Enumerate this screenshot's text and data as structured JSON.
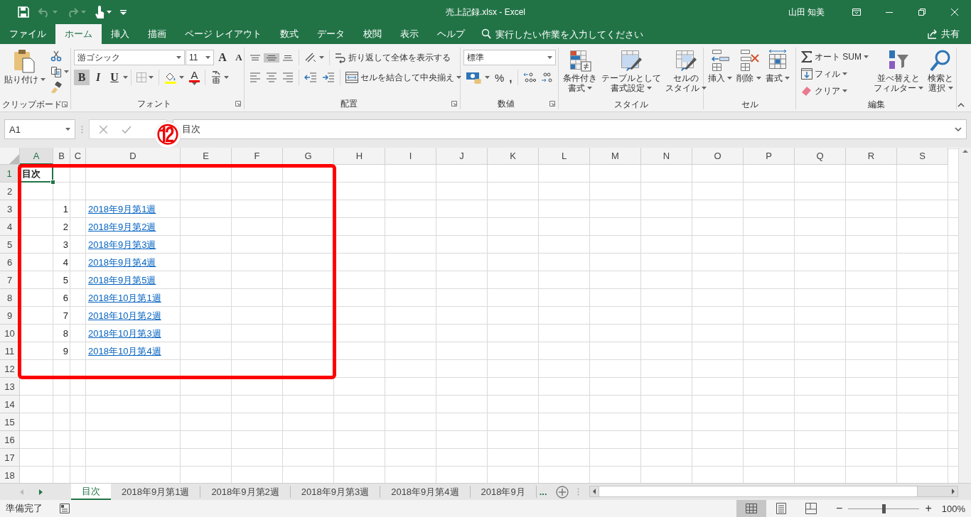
{
  "window": {
    "title": "売上記録.xlsx  -  Excel",
    "user": "山田 知美"
  },
  "quick_access": [
    {
      "kind": "save",
      "disabled": false
    },
    {
      "kind": "undo",
      "disabled": true
    },
    {
      "kind": "redo",
      "disabled": true
    },
    {
      "kind": "touch",
      "disabled": false
    },
    {
      "kind": "customize",
      "disabled": false
    }
  ],
  "menu_tabs": [
    {
      "label": "ファイル",
      "selected": false
    },
    {
      "label": "ホーム",
      "selected": true
    },
    {
      "label": "挿入",
      "selected": false
    },
    {
      "label": "描画",
      "selected": false
    },
    {
      "label": "ページ レイアウト",
      "selected": false
    },
    {
      "label": "数式",
      "selected": false
    },
    {
      "label": "データ",
      "selected": false
    },
    {
      "label": "校閲",
      "selected": false
    },
    {
      "label": "表示",
      "selected": false
    },
    {
      "label": "ヘルプ",
      "selected": false
    }
  ],
  "tell_me": {
    "placeholder": "実行したい作業を入力してください"
  },
  "share": "共有",
  "ribbon": {
    "clipboard": {
      "label": "クリップボード",
      "paste": "貼り付け"
    },
    "font": {
      "label": "フォント",
      "font_name": "游ゴシック",
      "font_size": "11",
      "grow": "A",
      "shrink": "A",
      "bold": {
        "text": "B",
        "selected": true
      },
      "italic": {
        "text": "I",
        "selected": false
      },
      "underline": {
        "text": "U",
        "selected": false
      },
      "font_color": "A"
    },
    "alignment": {
      "label": "配置",
      "vertical_align": [
        {
          "selected": false
        },
        {
          "selected": true
        },
        {
          "selected": false
        }
      ],
      "wrap": "折り返して全体を表示する",
      "merge": "セルを結合して中央揃え"
    },
    "number": {
      "label": "数値",
      "format": "標準",
      "percent": "%",
      "comma": ","
    },
    "styles": {
      "label": "スタイル",
      "conditional": [
        "条件付き",
        "書式"
      ],
      "table": [
        "テーブルとして",
        "書式設定"
      ],
      "cell_styles": [
        "セルの",
        "スタイル"
      ]
    },
    "cells": {
      "label": "セル",
      "insert": "挿入",
      "delete": "削除",
      "format": "書式"
    },
    "editing": {
      "label": "編集",
      "autosum": "オート SUM",
      "fill": "フィル",
      "clear": "クリア",
      "sort": [
        "並べ替えと",
        "フィルター"
      ],
      "find": [
        "検索と",
        "選択"
      ]
    }
  },
  "formula_bar": {
    "name_box": "A1",
    "formula": "目次"
  },
  "callout": "⑫",
  "columns": [
    {
      "label": "A",
      "selected": true
    },
    {
      "label": "B",
      "selected": false
    },
    {
      "label": "C",
      "selected": false
    },
    {
      "label": "D",
      "selected": false
    },
    {
      "label": "E",
      "selected": false
    },
    {
      "label": "F",
      "selected": false
    },
    {
      "label": "G",
      "selected": false
    },
    {
      "label": "H",
      "selected": false
    },
    {
      "label": "I",
      "selected": false
    },
    {
      "label": "J",
      "selected": false
    },
    {
      "label": "K",
      "selected": false
    },
    {
      "label": "L",
      "selected": false
    },
    {
      "label": "M",
      "selected": false
    },
    {
      "label": "N",
      "selected": false
    },
    {
      "label": "O",
      "selected": false
    },
    {
      "label": "P",
      "selected": false
    },
    {
      "label": "Q",
      "selected": false
    },
    {
      "label": "R",
      "selected": false
    },
    {
      "label": "S",
      "selected": false
    }
  ],
  "rows": [
    {
      "header": "1",
      "selected": true,
      "title": "目次"
    },
    {
      "header": "2",
      "selected": false
    },
    {
      "header": "3",
      "selected": false,
      "number": "1",
      "link": "2018年9月第1週"
    },
    {
      "header": "4",
      "selected": false,
      "number": "2",
      "link": "2018年9月第2週"
    },
    {
      "header": "5",
      "selected": false,
      "number": "3",
      "link": "2018年9月第3週"
    },
    {
      "header": "6",
      "selected": false,
      "number": "4",
      "link": "2018年9月第4週"
    },
    {
      "header": "7",
      "selected": false,
      "number": "5",
      "link": "2018年9月第5週"
    },
    {
      "header": "8",
      "selected": false,
      "number": "6",
      "link": "2018年10月第1週"
    },
    {
      "header": "9",
      "selected": false,
      "number": "7",
      "link": "2018年10月第2週"
    },
    {
      "header": "10",
      "selected": false,
      "number": "8",
      "link": "2018年10月第3週"
    },
    {
      "header": "11",
      "selected": false,
      "number": "9",
      "link": "2018年10月第4週"
    },
    {
      "header": "12",
      "selected": false
    },
    {
      "header": "13",
      "selected": false
    },
    {
      "header": "14",
      "selected": false
    },
    {
      "header": "15",
      "selected": false
    },
    {
      "header": "16",
      "selected": false
    },
    {
      "header": "17",
      "selected": false
    },
    {
      "header": "18",
      "selected": false
    }
  ],
  "sheet_tabs": [
    {
      "label": "目次",
      "selected": true
    },
    {
      "label": "2018年9月第1週",
      "selected": false
    },
    {
      "label": "2018年9月第2週",
      "selected": false
    },
    {
      "label": "2018年9月第3週",
      "selected": false
    },
    {
      "label": "2018年9月第4週",
      "selected": false
    },
    {
      "label": "2018年9月",
      "selected": false
    }
  ],
  "more_tabs": "...",
  "status_bar": {
    "status": "準備完了",
    "views": [
      {
        "selected": true
      },
      {
        "selected": false
      },
      {
        "selected": false
      }
    ],
    "zoom_out": "−",
    "zoom_in": "+",
    "zoom": {
      "level": 0.5
    },
    "zoom_label": "100%"
  }
}
